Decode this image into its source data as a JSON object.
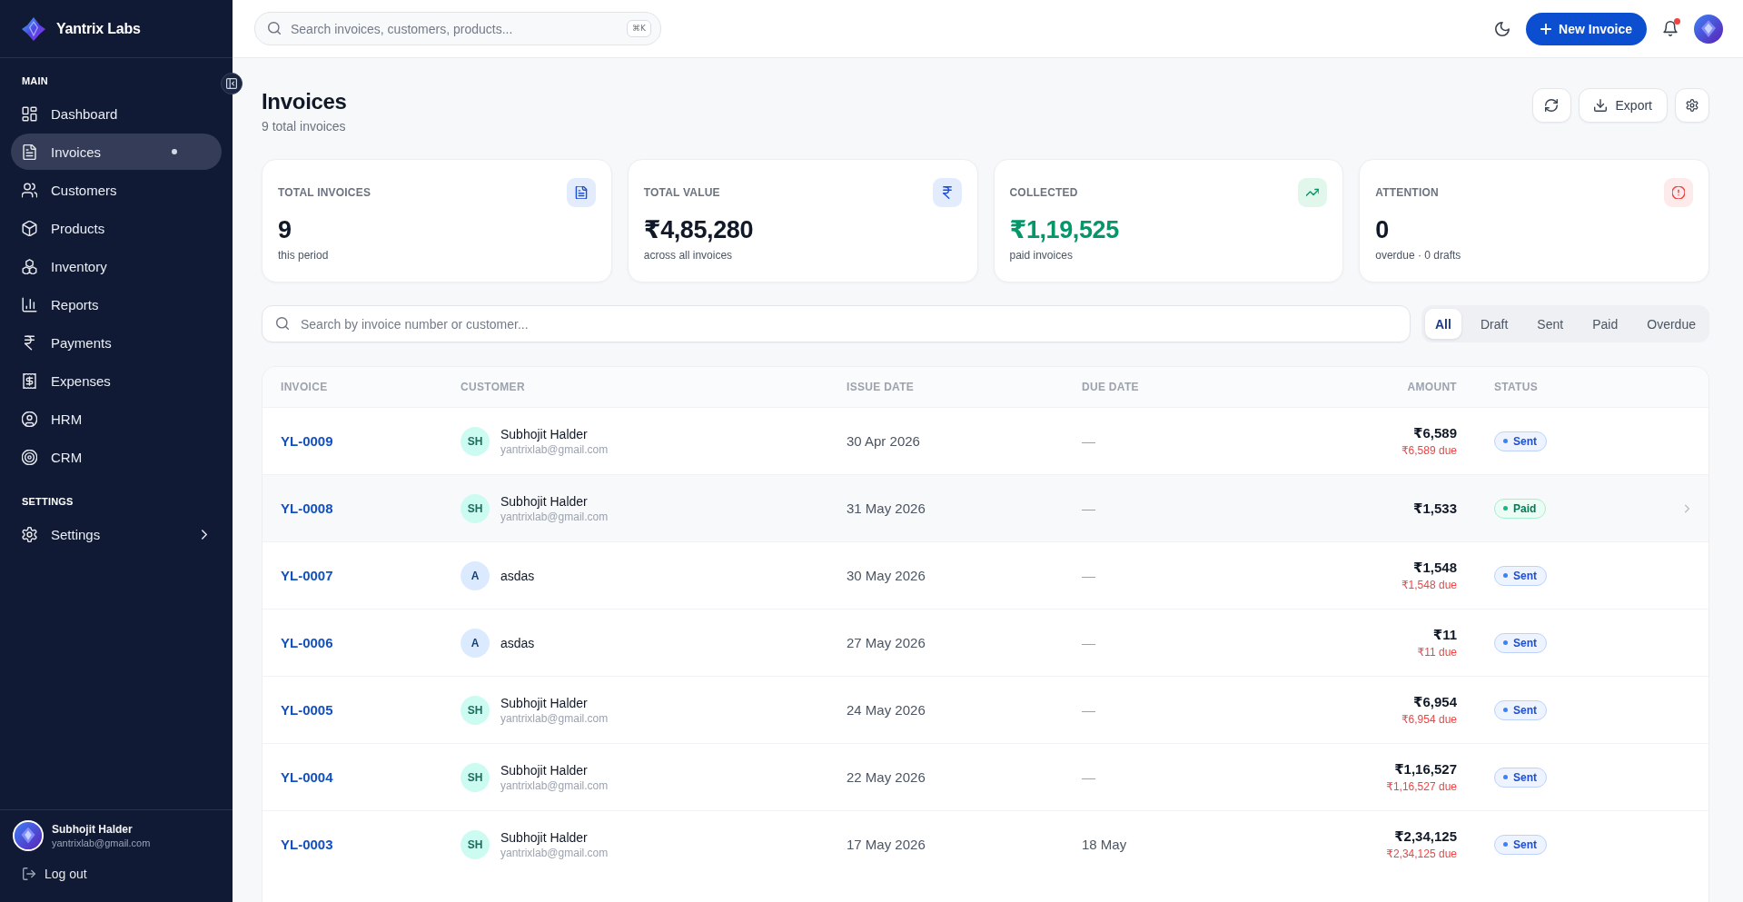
{
  "sidebar": {
    "brand": "Yantrix Labs",
    "sections": [
      {
        "title": "MAIN",
        "items": [
          {
            "label": "Dashboard",
            "selected": false,
            "has_submenu": false
          },
          {
            "label": "Invoices",
            "selected": true,
            "has_submenu": false
          },
          {
            "label": "Customers",
            "selected": false,
            "has_submenu": false
          },
          {
            "label": "Products",
            "selected": false,
            "has_submenu": false
          },
          {
            "label": "Inventory",
            "selected": false,
            "has_submenu": false
          },
          {
            "label": "Reports",
            "selected": false,
            "has_submenu": false
          },
          {
            "label": "Payments",
            "selected": false,
            "has_submenu": false
          },
          {
            "label": "Expenses",
            "selected": false,
            "has_submenu": false
          },
          {
            "label": "HRM",
            "selected": false,
            "has_submenu": false
          },
          {
            "label": "CRM",
            "selected": false,
            "has_submenu": false
          }
        ]
      },
      {
        "title": "SETTINGS",
        "items": [
          {
            "label": "Settings",
            "selected": false,
            "has_submenu": true
          }
        ]
      }
    ],
    "user": {
      "name": "Subhojit Halder",
      "email": "yantrixlab@gmail.com"
    },
    "logout": "Log out"
  },
  "topbar": {
    "search": {
      "placeholder": "Search invoices, customers, products...",
      "shortcut": "⌘K"
    },
    "new_button": "New Invoice",
    "notifications": {
      "unread": true
    }
  },
  "header": {
    "title": "Invoices",
    "subtitle": "9 total invoices",
    "export_button": "Export"
  },
  "stats": [
    {
      "kind": "invoices",
      "label": "TOTAL INVOICES",
      "value": "9",
      "note": "this period"
    },
    {
      "kind": "value",
      "label": "TOTAL VALUE",
      "value": "₹4,85,280",
      "note": "across all invoices"
    },
    {
      "kind": "collected",
      "label": "COLLECTED",
      "value": "₹1,19,525",
      "note": "paid invoices"
    },
    {
      "kind": "attention",
      "label": "ATTENTION",
      "value": "0",
      "note": "overdue · 0 drafts"
    }
  ],
  "filters": {
    "search": {
      "placeholder": "Search by invoice number or customer..."
    },
    "tabs": [
      {
        "label": "All",
        "selected": true
      },
      {
        "label": "Draft",
        "selected": false
      },
      {
        "label": "Sent",
        "selected": false
      },
      {
        "label": "Paid",
        "selected": false
      },
      {
        "label": "Overdue",
        "selected": false
      }
    ]
  },
  "table": {
    "columns": [
      "INVOICE",
      "CUSTOMER",
      "ISSUE DATE",
      "DUE DATE",
      "AMOUNT",
      "STATUS"
    ],
    "rows": [
      {
        "number": "YL-0009",
        "customer": {
          "initials": "SH",
          "name": "Subhojit Halder",
          "email": "yantrixlab@gmail.com",
          "color": "#ccfbf1"
        },
        "issue_date": "30 Apr 2026",
        "due": {
          "text": "—",
          "muted": true
        },
        "amount": "₹6,589",
        "balance": "₹6,589 due",
        "status": {
          "kind": "sent",
          "label": "Sent"
        },
        "hovered": false
      },
      {
        "number": "YL-0008",
        "customer": {
          "initials": "SH",
          "name": "Subhojit Halder",
          "email": "yantrixlab@gmail.com",
          "color": "#ccfbf1"
        },
        "issue_date": "31 May 2026",
        "due": {
          "text": "—",
          "muted": true
        },
        "amount": "₹1,533",
        "status": {
          "kind": "paid",
          "label": "Paid"
        },
        "hovered": true
      },
      {
        "number": "YL-0007",
        "customer": {
          "initials": "A",
          "name": "asdas",
          "color": "#dbeafe"
        },
        "issue_date": "30 May 2026",
        "due": {
          "text": "—",
          "muted": true
        },
        "amount": "₹1,548",
        "balance": "₹1,548 due",
        "status": {
          "kind": "sent",
          "label": "Sent"
        },
        "hovered": false
      },
      {
        "number": "YL-0006",
        "customer": {
          "initials": "A",
          "name": "asdas",
          "color": "#dbeafe"
        },
        "issue_date": "27 May 2026",
        "due": {
          "text": "—",
          "muted": true
        },
        "amount": "₹11",
        "balance": "₹11 due",
        "status": {
          "kind": "sent",
          "label": "Sent"
        },
        "hovered": false
      },
      {
        "number": "YL-0005",
        "customer": {
          "initials": "SH",
          "name": "Subhojit Halder",
          "email": "yantrixlab@gmail.com",
          "color": "#ccfbf1"
        },
        "issue_date": "24 May 2026",
        "due": {
          "text": "—",
          "muted": true
        },
        "amount": "₹6,954",
        "balance": "₹6,954 due",
        "status": {
          "kind": "sent",
          "label": "Sent"
        },
        "hovered": false
      },
      {
        "number": "YL-0004",
        "customer": {
          "initials": "SH",
          "name": "Subhojit Halder",
          "email": "yantrixlab@gmail.com",
          "color": "#ccfbf1"
        },
        "issue_date": "22 May 2026",
        "due": {
          "text": "—",
          "muted": true
        },
        "amount": "₹1,16,527",
        "balance": "₹1,16,527 due",
        "status": {
          "kind": "sent",
          "label": "Sent"
        },
        "hovered": false
      },
      {
        "number": "YL-0003",
        "customer": {
          "initials": "SH",
          "name": "Subhojit Halder",
          "email": "yantrixlab@gmail.com",
          "color": "#ccfbf1"
        },
        "issue_date": "17 May 2026",
        "due": {
          "text": "18 May",
          "muted": false
        },
        "amount": "₹2,34,125",
        "balance": "₹2,34,125 due",
        "status": {
          "kind": "sent",
          "label": "Sent"
        },
        "hovered": false
      }
    ]
  }
}
